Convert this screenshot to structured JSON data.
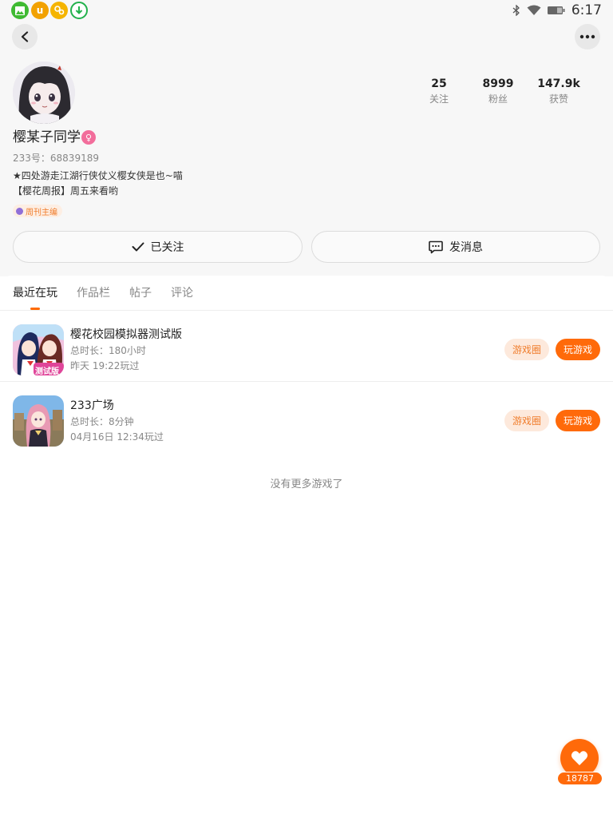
{
  "status_bar": {
    "time": "6:17",
    "app_icons": [
      {
        "name": "gallery-app-icon",
        "color": "#3fba32",
        "glyph": "▲"
      },
      {
        "name": "uc-browser-icon",
        "color": "#f2a100",
        "glyph": "u"
      },
      {
        "name": "game-app-icon",
        "color": "#f5b400",
        "glyph": "✿"
      },
      {
        "name": "download-app-icon",
        "color": "#22b14c",
        "glyph": "↓"
      }
    ],
    "system_icons": [
      "bluetooth-icon",
      "wifi-icon",
      "battery-icon"
    ]
  },
  "profile": {
    "username": "樱某子同学",
    "gender_icon": "female-icon",
    "uid": "233号：68839189",
    "bio_lines": [
      "★四处游走江湖行侠仗义樱女侠是也~喵",
      "【樱花周报】周五来看哟"
    ],
    "role_badge": "周刊主编",
    "stats": [
      {
        "value": "25",
        "label": "关注"
      },
      {
        "value": "8999",
        "label": "粉丝"
      },
      {
        "value": "147.9k",
        "label": "获赞"
      }
    ],
    "follow_button": "已关注",
    "message_button": "发消息"
  },
  "tabs": [
    {
      "label": "最近在玩",
      "active": true
    },
    {
      "label": "作品栏",
      "active": false
    },
    {
      "label": "帖子",
      "active": false
    },
    {
      "label": "评论",
      "active": false
    }
  ],
  "games": [
    {
      "name": "樱花校园模拟器测试版",
      "duration": "总时长：180小时",
      "last_played": "昨天 19:22玩过",
      "circle_button": "游戏圈",
      "play_button": "玩游戏",
      "icon_badge": "测试版"
    },
    {
      "name": "233广场",
      "duration": "总时长：8分钟",
      "last_played": "04月16日 12:34玩过",
      "circle_button": "游戏圈",
      "play_button": "玩游戏"
    }
  ],
  "no_more_text": "没有更多游戏了",
  "like_fab": {
    "count": "18787"
  },
  "colors": {
    "accent": "#ff6a0a",
    "accent_light": "#fde9dc",
    "header_bg": "#f7f7f7"
  }
}
